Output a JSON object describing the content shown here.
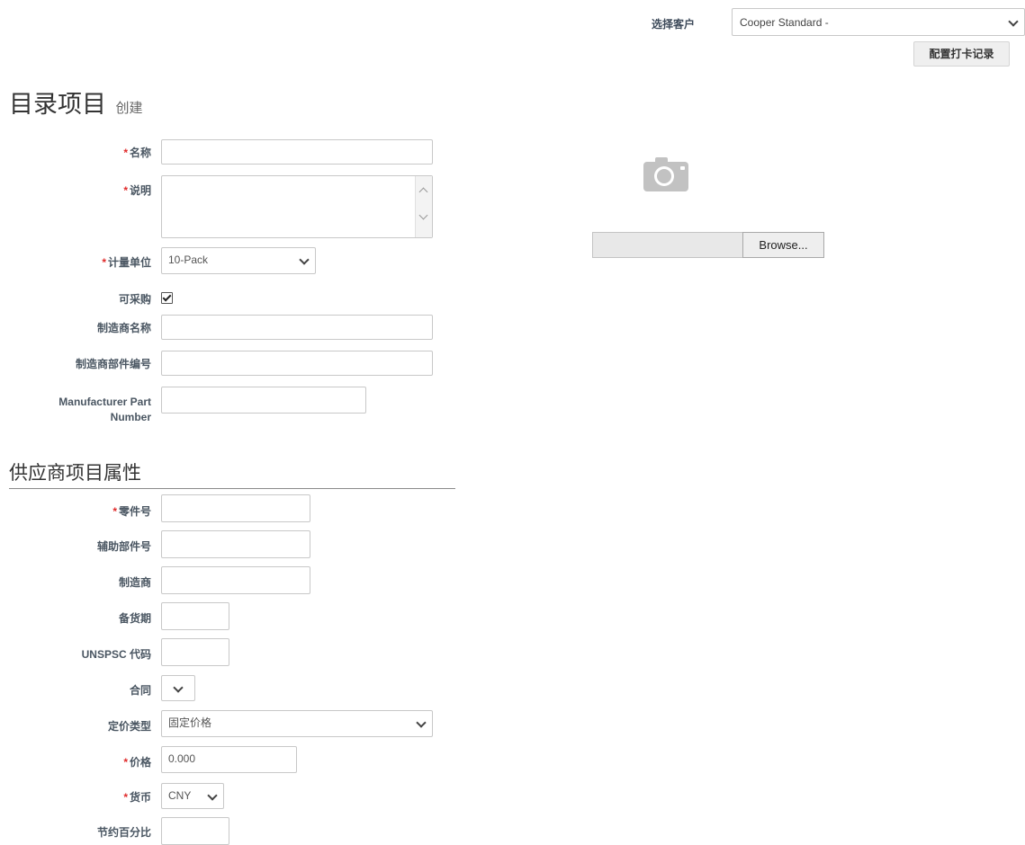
{
  "header": {
    "customer_label": "选择客户",
    "customer_value": "Cooper Standard -",
    "config_button": "配置打卡记录"
  },
  "page": {
    "title": "目录项目",
    "subtitle": "创建"
  },
  "form": {
    "name_label": "名称",
    "description_label": "说明",
    "uom_label": "计量单位",
    "uom_value": "10-Pack",
    "purchasable_label": "可采购",
    "purchasable_checked": true,
    "manufacturer_name_label": "制造商名称",
    "manufacturer_part_cn_label": "制造商部件编号",
    "manufacturer_part_en_label_line1": "Manufacturer Part",
    "manufacturer_part_en_label_line2": "Number"
  },
  "image": {
    "browse_label": "Browse..."
  },
  "supplier": {
    "section_title": "供应商项目属性",
    "part_number_label": "零件号",
    "aux_part_label": "辅助部件号",
    "manufacturer_label": "制造商",
    "lead_time_label": "备货期",
    "unspsc_label": "UNSPSC 代码",
    "contract_label": "合同",
    "pricing_type_label": "定价类型",
    "pricing_type_value": "固定价格",
    "price_label": "价格",
    "price_value": "0.000",
    "currency_label": "货币",
    "currency_value": "CNY",
    "savings_label": "节约百分比"
  }
}
